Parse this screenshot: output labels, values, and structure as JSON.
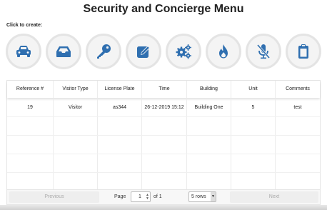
{
  "page": {
    "title": "Security and Concierge Menu",
    "create_label": "Click to create:"
  },
  "icons": [
    {
      "name": "car-icon"
    },
    {
      "name": "inbox-icon"
    },
    {
      "name": "key-icon"
    },
    {
      "name": "edit-icon"
    },
    {
      "name": "gears-icon"
    },
    {
      "name": "fire-icon"
    },
    {
      "name": "mute-microphone-icon"
    },
    {
      "name": "clipboard-icon"
    }
  ],
  "colors": {
    "icon": "#2f6fb0",
    "circle_bg": "#f4f4f4",
    "circle_border": "#e4e4e4"
  },
  "table": {
    "headers": [
      "Reference #",
      "Visitor Type",
      "License Plate",
      "Time",
      "Building",
      "Unit",
      "Comments"
    ],
    "rows": [
      [
        "19",
        "Visitor",
        "as344",
        "26-12-2019 15:12",
        "Building One",
        "5",
        "test"
      ]
    ]
  },
  "pager": {
    "previous": "Previous",
    "page_label": "Page",
    "page_value": "1",
    "of_label": "of 1",
    "rows_value": "5 rows",
    "next": "Next"
  }
}
